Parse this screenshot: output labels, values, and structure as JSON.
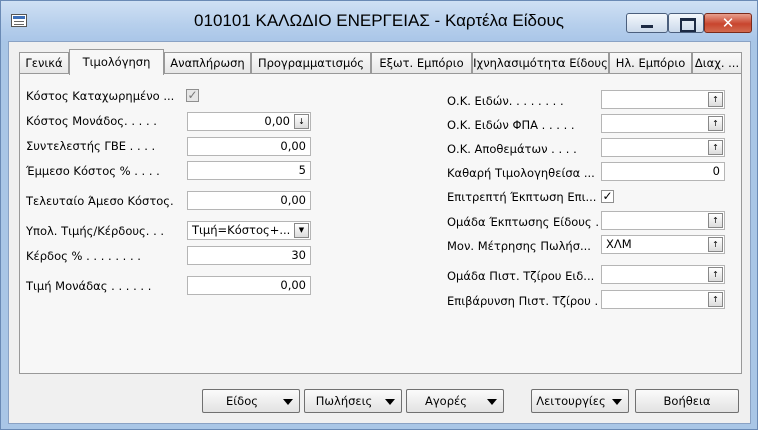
{
  "window": {
    "title": "010101 ΚΑΛΩΔΙΟ ΕΝΕΡΓΕΙΑΣ - Καρτέλα Είδους"
  },
  "tabs": [
    {
      "label": "Γενικά"
    },
    {
      "label": "Τιμολόγηση"
    },
    {
      "label": "Αναπλήρωση"
    },
    {
      "label": "Προγραμματισμός"
    },
    {
      "label": "Εξωτ. Εμπόριο"
    },
    {
      "label": "Ιχνηλασιμότητα Είδους"
    },
    {
      "label": "Ηλ. Εμπόριο"
    },
    {
      "label": "Διαχ. ..."
    }
  ],
  "left_fields": {
    "cost_recorded": {
      "label": "Κόστος Καταχωρημένο ...",
      "checked": true
    },
    "unit_cost": {
      "label": "Κόστος Μονάδος. . . . .",
      "value": "0,00",
      "button": "↓"
    },
    "gve_factor": {
      "label": "Συντελεστής ΓΒΕ . . . .",
      "value": "0,00"
    },
    "indirect_cost": {
      "label": "Έμμεσο Κόστος % . . . .",
      "value": "5"
    },
    "last_direct_cost": {
      "label": "Τελευταίο Άμεσο Κόστος.",
      "value": "0,00"
    },
    "price_profit_calc": {
      "label": "Υπολ. Τιμής/Κέρδους. . .",
      "value": "Τιμή=Κόστος+..."
    },
    "profit_pct": {
      "label": "Κέρδος % . . . . . . . .",
      "value": "30"
    },
    "unit_price": {
      "label": "Τιμή Μονάδας . . . . . .",
      "value": "0,00"
    }
  },
  "right_fields": {
    "gen_prod_group": {
      "label": "Ο.Κ. Ειδών. . . . . . . .",
      "value": ""
    },
    "vat_prod_group": {
      "label": "Ο.Κ. Ειδών ΦΠΑ . . . . .",
      "value": ""
    },
    "inventory_group": {
      "label": "Ο.Κ. Αποθεμάτων . . . .",
      "value": ""
    },
    "net_invoiced": {
      "label": "Καθαρή Τιμολογηθείσα ...",
      "value": "0"
    },
    "allow_discount": {
      "label": "Επιτρεπτή Έκπτωση Επι...",
      "checked": true
    },
    "discount_group": {
      "label": "Ομάδα Έκπτωσης Είδους .",
      "value": ""
    },
    "sales_uom": {
      "label": "Μον. Μέτρησης Πωλήσ...",
      "value": "ΧΛΜ"
    },
    "credit_turnover_group": {
      "label": "Ομάδα Πιστ. Τζίρου Ειδ...",
      "value": ""
    },
    "credit_turnover_charge": {
      "label": "Επιβάρυνση Πιστ. Τζίρου .",
      "value": ""
    }
  },
  "lookup_icon": "↑",
  "dropdown_icon": "▼",
  "bottom_buttons": {
    "item": "Είδος",
    "sales": "Πωλήσεις",
    "purchases": "Αγορές",
    "functions": "Λειτουργίες",
    "help": "Βοήθεια"
  }
}
